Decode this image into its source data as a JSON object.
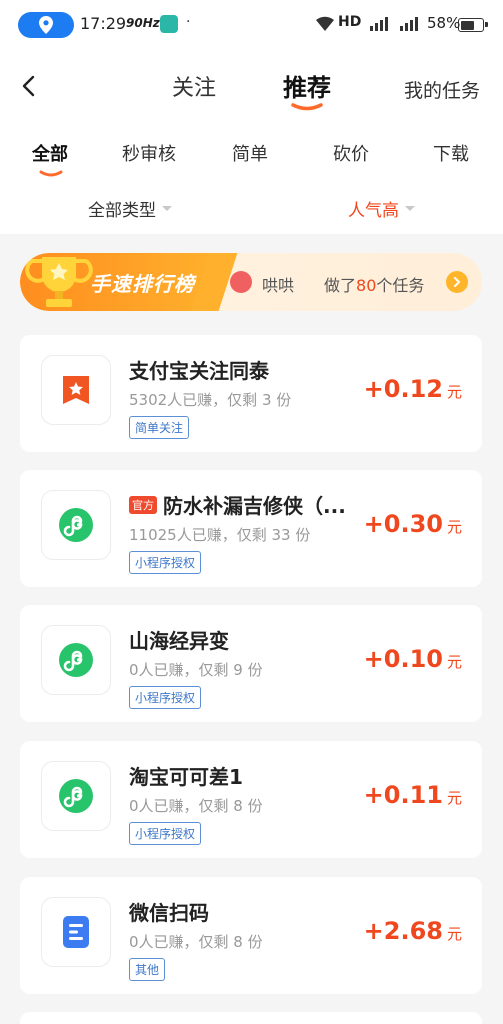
{
  "status_bar": {
    "time": "17:29",
    "refresh_rate": "90Hz",
    "network": "HD",
    "battery": "58%"
  },
  "header": {
    "tabs": [
      "关注",
      "推荐"
    ],
    "active_tab": "推荐",
    "my_tasks": "我的任务"
  },
  "categories": [
    "全部",
    "秒审核",
    "简单",
    "砍价",
    "下载"
  ],
  "active_category": "全部",
  "filters": {
    "type": "全部类型",
    "sort": "人气高"
  },
  "rank_banner": {
    "title": "手速排行榜",
    "user": "哄哄",
    "desc_prefix": "做了",
    "count": "80",
    "desc_suffix": "个任务"
  },
  "tasks": [
    {
      "title": "支付宝关注同泰",
      "official": false,
      "meta": "5302人已赚，仅剩 3 份",
      "tag": "简单关注",
      "reward": "+0.12",
      "unit": "元",
      "icon": "alipay-star-icon"
    },
    {
      "title": "防水补漏吉修侠（...",
      "official": true,
      "badge": "官方",
      "meta": "11025人已赚，仅剩 33 份",
      "tag": "小程序授权",
      "reward": "+0.30",
      "unit": "元",
      "icon": "miniprogram-icon"
    },
    {
      "title": "山海经异变",
      "official": false,
      "meta": "0人已赚，仅剩 9 份",
      "tag": "小程序授权",
      "reward": "+0.10",
      "unit": "元",
      "icon": "miniprogram-icon"
    },
    {
      "title": "淘宝可可差1",
      "official": false,
      "meta": "0人已赚，仅剩 8 份",
      "tag": "小程序授权",
      "reward": "+0.11",
      "unit": "元",
      "icon": "miniprogram-icon"
    },
    {
      "title": "微信扫码",
      "official": false,
      "meta": "0人已赚，仅剩 8 份",
      "tag": "其他",
      "reward": "+2.68",
      "unit": "元",
      "icon": "document-icon"
    }
  ],
  "colors": {
    "accent": "#f0481e",
    "tab_underline": "#ff6a2b",
    "tag_blue": "#3f78c8",
    "mini_green": "#27c46b"
  }
}
